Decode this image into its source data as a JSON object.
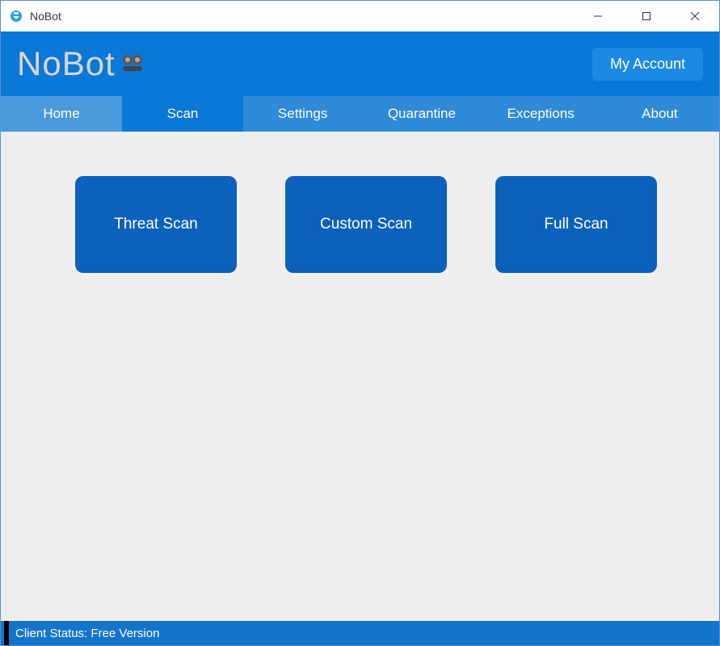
{
  "window": {
    "title": "NoBot"
  },
  "header": {
    "logo_text": "NoBot",
    "account_label": "My Account"
  },
  "nav": {
    "items": [
      {
        "label": "Home"
      },
      {
        "label": "Scan"
      },
      {
        "label": "Settings"
      },
      {
        "label": "Quarantine"
      },
      {
        "label": "Exceptions"
      },
      {
        "label": "About"
      }
    ],
    "active_index": 1
  },
  "scan_buttons": [
    {
      "label": "Threat Scan"
    },
    {
      "label": "Custom Scan"
    },
    {
      "label": "Full Scan"
    }
  ],
  "status": {
    "text": "Client Status: Free Version"
  },
  "colors": {
    "header": "#0a78d6",
    "navbar": "#2f8ad8",
    "nav_home": "#4a99db",
    "button": "#0c61bd",
    "content_bg": "#eeeeee",
    "statusbar": "#1474cc"
  }
}
